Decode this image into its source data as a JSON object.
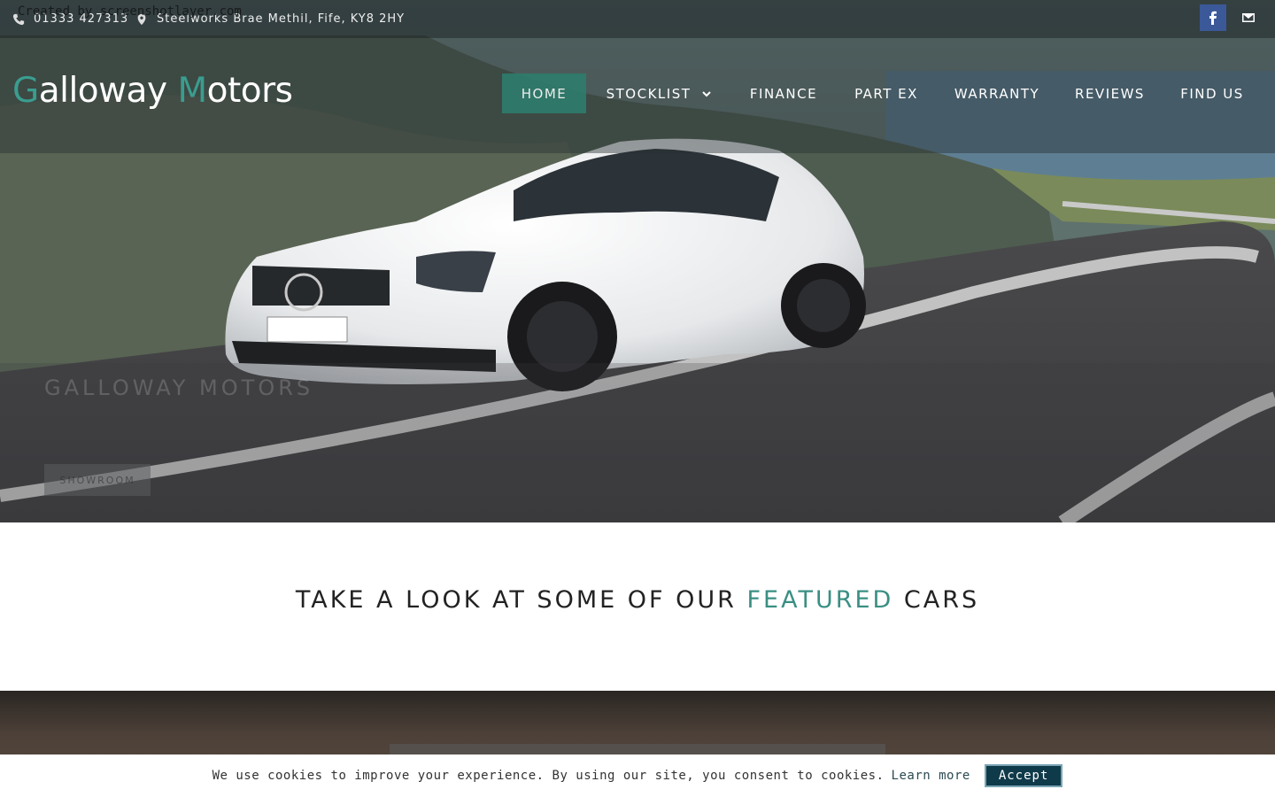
{
  "watermark": "Created by screenshotlayer.com",
  "topbar": {
    "phone": "01333 427313",
    "address": "Steelworks Brae Methil, Fife, KY8 2HY"
  },
  "logo": {
    "g": "G",
    "alloway": "alloway ",
    "m": "M",
    "otors": "otors"
  },
  "nav": {
    "home": "HOME",
    "stocklist": "STOCKLIST",
    "finance": "FINANCE",
    "part_ex": "PART EX",
    "warranty": "WARRANTY",
    "reviews": "REVIEWS",
    "find_us": "FIND US"
  },
  "hero": {
    "title": "GALLOWAY MOTORS",
    "button": "SHOWROOM"
  },
  "featured": {
    "prefix": "TAKE A LOOK AT SOME OF OUR ",
    "highlight": "FEATURED",
    "suffix": " CARS"
  },
  "cookie": {
    "message": "We use cookies to improve your experience. By using our site, you consent to cookies.",
    "learn_more": "Learn more",
    "accept": "Accept"
  },
  "colors": {
    "accent": "#3a9d8f",
    "nav_active": "#2e7d6d",
    "facebook": "#3b5998"
  },
  "icons": [
    "phone-icon",
    "map-marker-icon",
    "facebook-icon",
    "envelope-icon",
    "chevron-down-icon"
  ]
}
